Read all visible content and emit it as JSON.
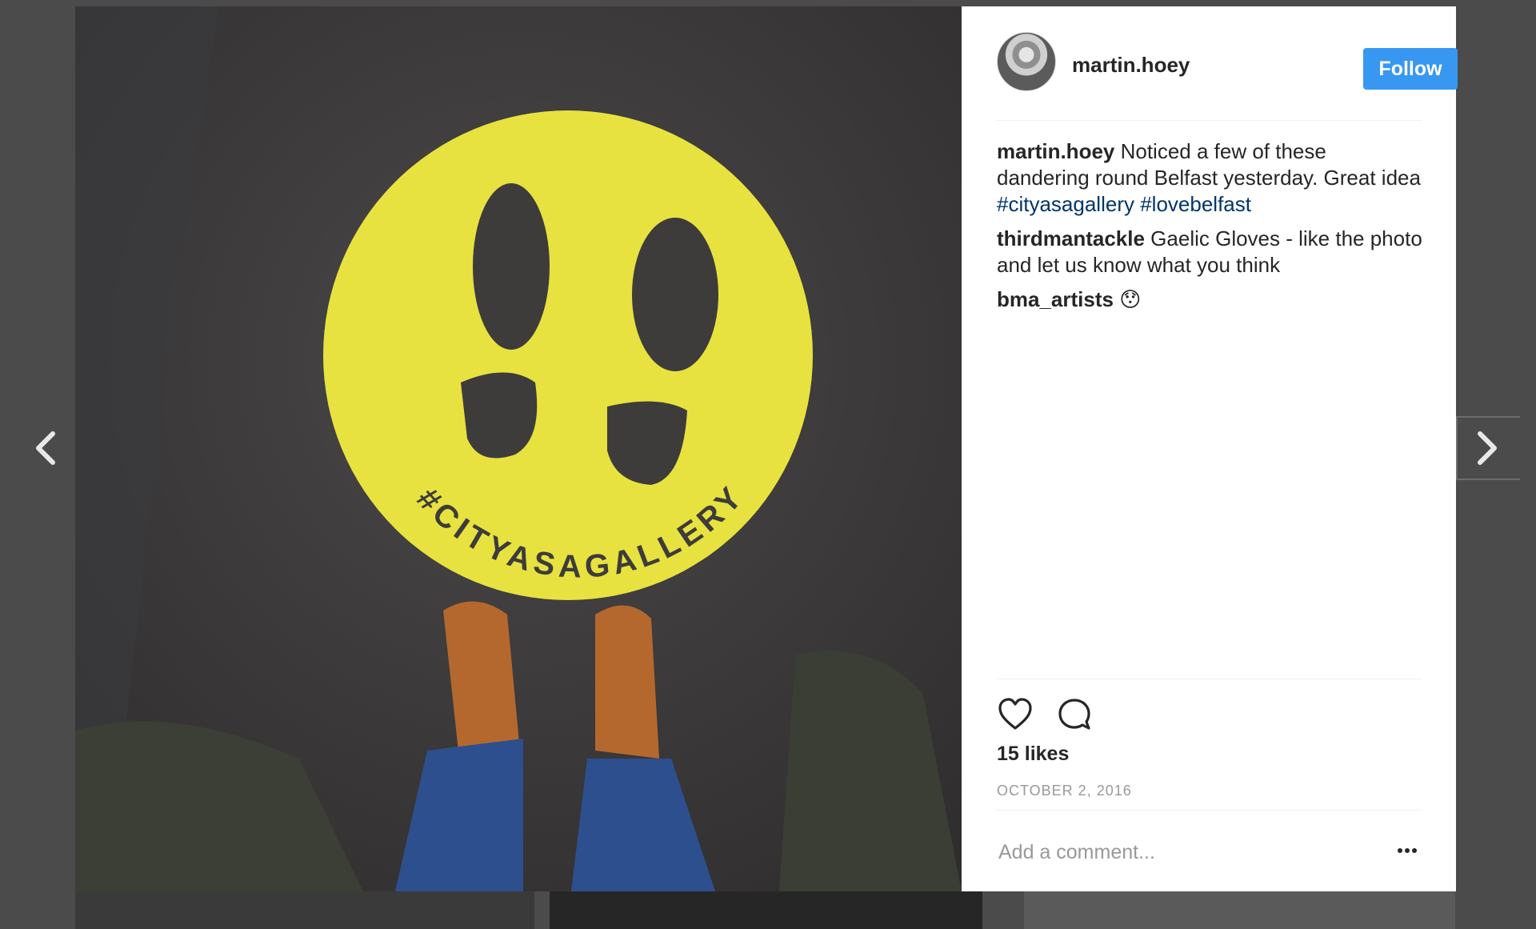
{
  "post": {
    "username": "martin.hoey",
    "follow_label": "Follow",
    "comments": [
      {
        "author": "martin.hoey",
        "text": " Noticed a few of these dandering round Belfast yesterday. Great idea ",
        "hashtags": [
          "#cityasagallery",
          "#lovebelfast"
        ]
      },
      {
        "author": "thirdmantackle",
        "text": " Gaelic Gloves - like the photo and let us know what you think",
        "hashtags": []
      },
      {
        "author": "bma_artists",
        "text": " 😯",
        "hashtags": []
      }
    ],
    "likes": "15 likes",
    "date": "OCTOBER 2, 2016",
    "comment_placeholder": "Add a comment...",
    "more_label": "•••"
  },
  "photo": {
    "sticker_text": "#CITYASAGALLERY"
  },
  "colors": {
    "follow_button": "#3897f0",
    "hashtag": "#003569",
    "sticker_yellow": "#e7e23f",
    "backdrop": "#4b4b4b"
  },
  "icons": [
    "chevron-left-icon",
    "chevron-right-icon",
    "heart-icon",
    "comment-icon",
    "more-icon"
  ]
}
